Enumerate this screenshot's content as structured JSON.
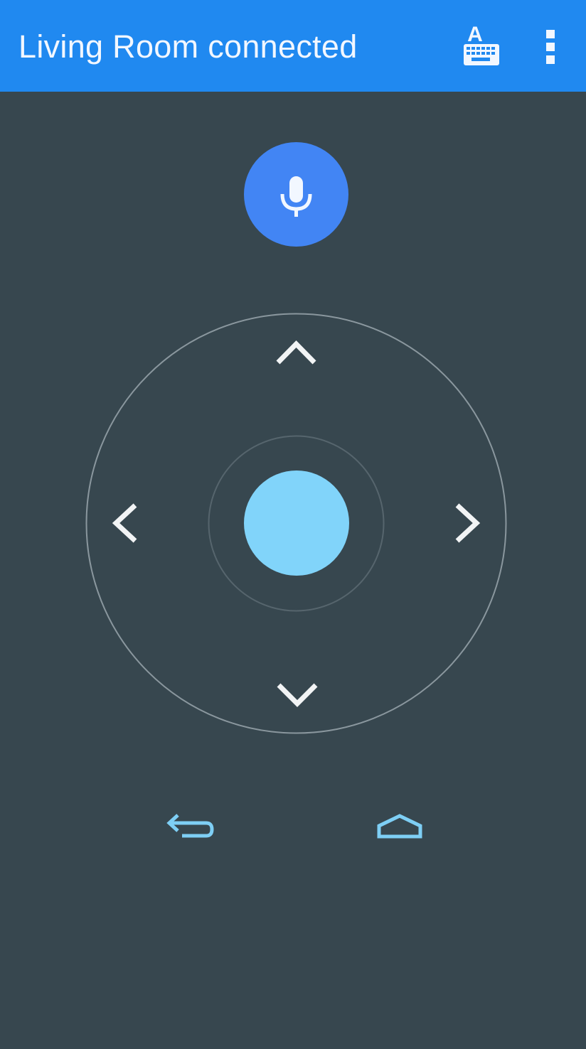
{
  "app_bar": {
    "title": "Living Room connected",
    "background_color": "#2089f0",
    "keyboard_icon": "keyboard-icon",
    "overflow_icon": "more-vert-icon"
  },
  "remote": {
    "background_color": "#37474f",
    "mic_button": {
      "icon": "microphone-icon",
      "color": "#4285f4"
    },
    "dpad": {
      "up_icon": "chevron-up-icon",
      "down_icon": "chevron-down-icon",
      "left_icon": "chevron-left-icon",
      "right_icon": "chevron-right-icon",
      "center_button_color": "#81d4fa",
      "ring_color": "#8a979e"
    },
    "nav": {
      "back_icon": "back-arrow-icon",
      "home_icon": "home-icon",
      "icon_color": "#7ecff5"
    }
  }
}
